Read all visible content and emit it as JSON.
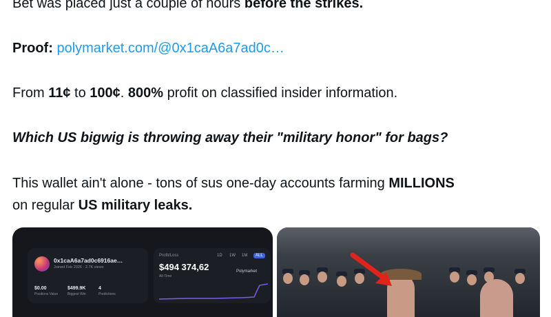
{
  "tweet": {
    "line1_normal": "Bet was placed just a couple of hours ",
    "line1_bold": "before the strikes.",
    "proof_label": "Proof:",
    "proof_link": "polymarket.com/@0x1caA6a7ad0c…",
    "line3_a": "From ",
    "line3_b": "11¢",
    "line3_c": " to ",
    "line3_d": "100¢",
    "line3_e": ". ",
    "line3_f": "800%",
    "line3_g": " profit on classified insider information.",
    "question": "Which US bigwig is throwing away their \"military honor\" for bags?",
    "line5_a": "This wallet ain't alone - tons of sus one-day accounts farming ",
    "line5_b": "MILLIONS",
    "line6_a": "on regular ",
    "line6_b": "US military leaks."
  },
  "media_left": {
    "wallet_name": "0x1caA6a7ad0c6916ae…",
    "joined": "Joined Feb 2026 · 2.7K views",
    "profit_loss_label": "Profit/Loss",
    "profit_value": "$494 374,62",
    "all_time": "All-Time",
    "brand": "Polymarket",
    "time_filters": [
      "1D",
      "1W",
      "1M",
      "ALL"
    ],
    "stats": [
      {
        "value": "$0.00",
        "label": "Positions Value"
      },
      {
        "value": "$499.9K",
        "label": "Biggest Win"
      },
      {
        "value": "4",
        "label": "Predictions"
      }
    ]
  },
  "colors": {
    "text": "#0f1419",
    "link": "#1d9bf0",
    "arrow": "#e0241c",
    "chart_line": "#7b5cf0"
  }
}
